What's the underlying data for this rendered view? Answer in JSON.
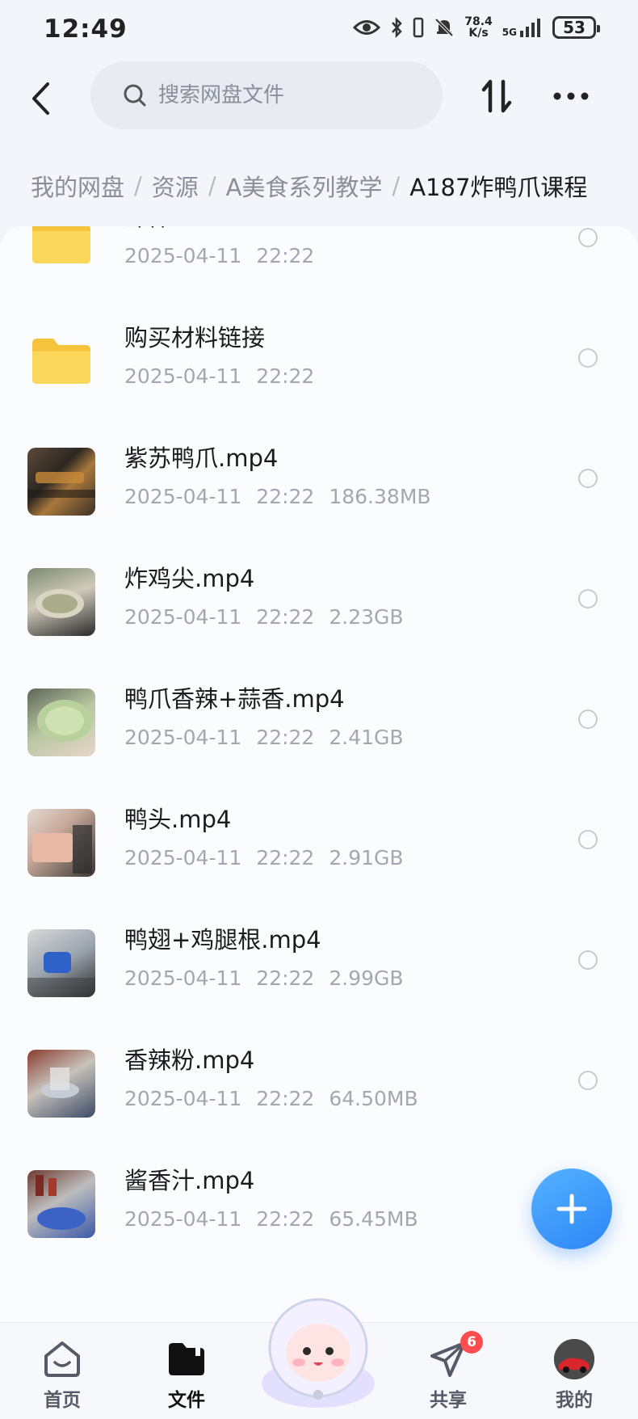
{
  "status_bar": {
    "time": "12:49",
    "net_speed_value": "78.4",
    "net_speed_unit": "K/s",
    "network": "5G",
    "battery": "53"
  },
  "header": {
    "search_placeholder": "搜索网盘文件"
  },
  "breadcrumb": {
    "items": [
      "我的网盘",
      "资源",
      "A美食系列教学",
      "A187炸鸭爪课程"
    ]
  },
  "files": [
    {
      "name": "课件",
      "date": "2025-04-11",
      "time": "22:22",
      "size": "",
      "type": "folder"
    },
    {
      "name": "购买材料链接",
      "date": "2025-04-11",
      "time": "22:22",
      "size": "",
      "type": "folder"
    },
    {
      "name": "紫苏鸭爪.mp4",
      "date": "2025-04-11",
      "time": "22:22",
      "size": "186.38MB",
      "type": "video"
    },
    {
      "name": "炸鸡尖.mp4",
      "date": "2025-04-11",
      "time": "22:22",
      "size": "2.23GB",
      "type": "video"
    },
    {
      "name": "鸭爪香辣+蒜香.mp4",
      "date": "2025-04-11",
      "time": "22:22",
      "size": "2.41GB",
      "type": "video"
    },
    {
      "name": "鸭头.mp4",
      "date": "2025-04-11",
      "time": "22:22",
      "size": "2.91GB",
      "type": "video"
    },
    {
      "name": "鸭翅+鸡腿根.mp4",
      "date": "2025-04-11",
      "time": "22:22",
      "size": "2.99GB",
      "type": "video"
    },
    {
      "name": "香辣粉.mp4",
      "date": "2025-04-11",
      "time": "22:22",
      "size": "64.50MB",
      "type": "video"
    },
    {
      "name": "酱香汁.mp4",
      "date": "2025-04-11",
      "time": "22:22",
      "size": "65.45MB",
      "type": "video"
    }
  ],
  "bottom_nav": {
    "home": "首页",
    "files": "文件",
    "share": "共享",
    "share_badge": "6",
    "me": "我的"
  },
  "colors": {
    "accent": "#2c86f7",
    "folder": "#f8cf4a",
    "badge": "#ff4d4f"
  }
}
